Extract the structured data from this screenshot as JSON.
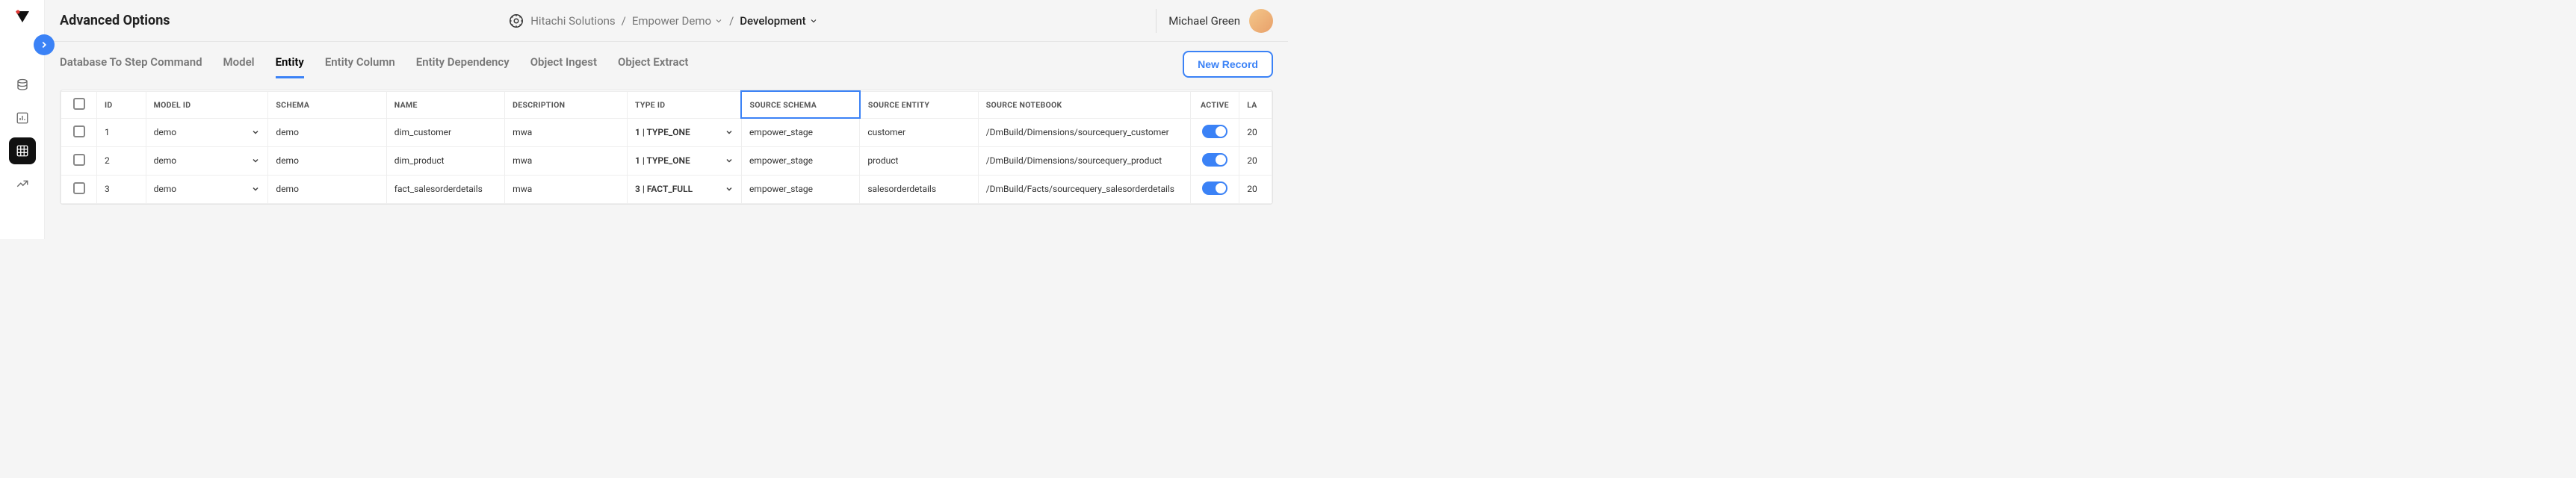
{
  "page": {
    "title": "Advanced Options"
  },
  "breadcrumb": {
    "org": "Hitachi Solutions",
    "project": "Empower Demo",
    "env": "Development"
  },
  "user": {
    "name": "Michael Green"
  },
  "tabs": [
    {
      "label": "Database To Step Command",
      "active": false
    },
    {
      "label": "Model",
      "active": false
    },
    {
      "label": "Entity",
      "active": true
    },
    {
      "label": "Entity Column",
      "active": false
    },
    {
      "label": "Entity Dependency",
      "active": false
    },
    {
      "label": "Object Ingest",
      "active": false
    },
    {
      "label": "Object Extract",
      "active": false
    }
  ],
  "actions": {
    "new_record": "New Record"
  },
  "table": {
    "columns": [
      "",
      "ID",
      "MODEL ID",
      "SCHEMA",
      "NAME",
      "DESCRIPTION",
      "TYPE ID",
      "SOURCE SCHEMA",
      "SOURCE ENTITY",
      "SOURCE NOTEBOOK",
      "ACTIVE",
      "LA"
    ],
    "selected_column_index": 7,
    "rows": [
      {
        "id": "1",
        "model_id": "demo",
        "schema": "demo",
        "name": "dim_customer",
        "description": "mwa",
        "type_id": "1 | TYPE_ONE",
        "source_schema": "empower_stage",
        "source_entity": "customer",
        "source_notebook": "/DmBuild/Dimensions/sourcequery_customer",
        "active": true,
        "last": "20"
      },
      {
        "id": "2",
        "model_id": "demo",
        "schema": "demo",
        "name": "dim_product",
        "description": "mwa",
        "type_id": "1 | TYPE_ONE",
        "source_schema": "empower_stage",
        "source_entity": "product",
        "source_notebook": "/DmBuild/Dimensions/sourcequery_product",
        "active": true,
        "last": "20"
      },
      {
        "id": "3",
        "model_id": "demo",
        "schema": "demo",
        "name": "fact_salesorderdetails",
        "description": "mwa",
        "type_id": "3 | FACT_FULL",
        "source_schema": "empower_stage",
        "source_entity": "salesorderdetails",
        "source_notebook": "/DmBuild/Facts/sourcequery_salesorderdetails",
        "active": true,
        "last": "20"
      }
    ]
  }
}
